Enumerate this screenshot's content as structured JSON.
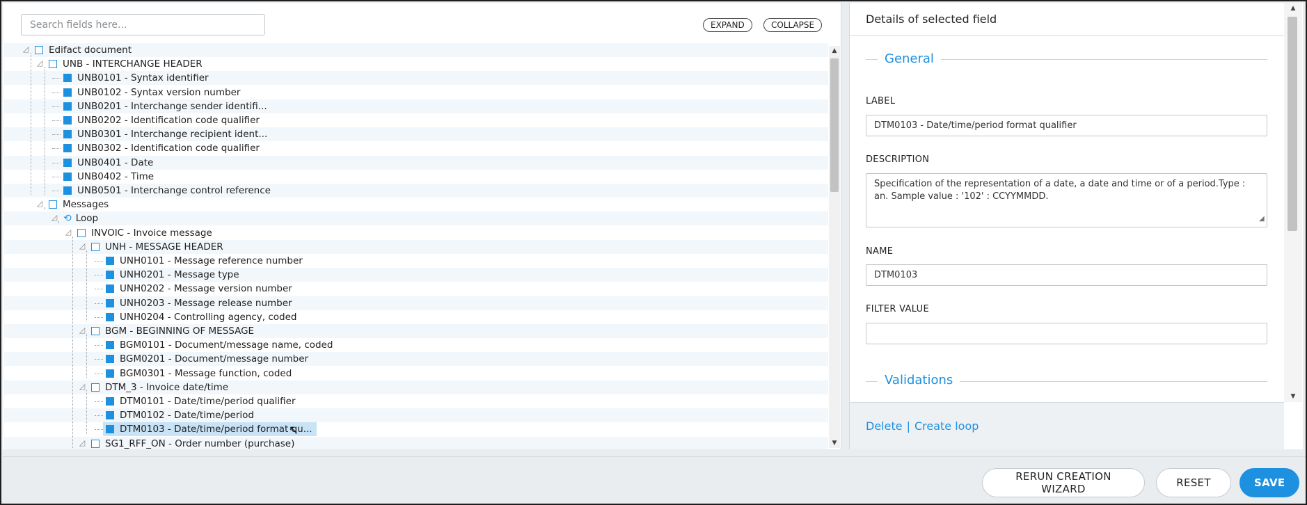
{
  "search": {
    "placeholder": "Search fields here..."
  },
  "toolbar": {
    "expand_label": "EXPAND",
    "collapse_label": "COLLAPSE"
  },
  "tree": {
    "rows": [
      {
        "label": "Edifact document",
        "depth": 0,
        "icon": "checkbox",
        "filled": false,
        "expander": true
      },
      {
        "label": "UNB - INTERCHANGE HEADER",
        "depth": 1,
        "icon": "checkbox",
        "filled": false,
        "expander": true
      },
      {
        "label": "UNB0101 - Syntax identifier",
        "depth": 2,
        "icon": "checkbox",
        "filled": true
      },
      {
        "label": "UNB0102 - Syntax version number",
        "depth": 2,
        "icon": "checkbox",
        "filled": true
      },
      {
        "label": "UNB0201 - Interchange sender identifi...",
        "depth": 2,
        "icon": "checkbox",
        "filled": true
      },
      {
        "label": "UNB0202 - Identification code qualifier",
        "depth": 2,
        "icon": "checkbox",
        "filled": true
      },
      {
        "label": "UNB0301 - Interchange recipient ident...",
        "depth": 2,
        "icon": "checkbox",
        "filled": true
      },
      {
        "label": "UNB0302 - Identification code qualifier",
        "depth": 2,
        "icon": "checkbox",
        "filled": true
      },
      {
        "label": "UNB0401 - Date",
        "depth": 2,
        "icon": "checkbox",
        "filled": true
      },
      {
        "label": "UNB0402 - Time",
        "depth": 2,
        "icon": "checkbox",
        "filled": true
      },
      {
        "label": "UNB0501 - Interchange control reference",
        "depth": 2,
        "icon": "checkbox",
        "filled": true
      },
      {
        "label": "Messages",
        "depth": 1,
        "icon": "checkbox",
        "filled": false,
        "expander": true
      },
      {
        "label": "Loop",
        "depth": 2,
        "icon": "loop-icon",
        "filled": false,
        "expander": true
      },
      {
        "label": "INVOIC - Invoice message",
        "depth": 3,
        "icon": "checkbox",
        "filled": false,
        "expander": true
      },
      {
        "label": "UNH - MESSAGE HEADER",
        "depth": 4,
        "icon": "checkbox",
        "filled": false,
        "expander": true
      },
      {
        "label": "UNH0101 - Message reference number",
        "depth": 5,
        "icon": "checkbox",
        "filled": true
      },
      {
        "label": "UNH0201 - Message type",
        "depth": 5,
        "icon": "checkbox",
        "filled": true
      },
      {
        "label": "UNH0202 - Message version number",
        "depth": 5,
        "icon": "checkbox",
        "filled": true
      },
      {
        "label": "UNH0203 - Message release number",
        "depth": 5,
        "icon": "checkbox",
        "filled": true
      },
      {
        "label": "UNH0204 - Controlling agency, coded",
        "depth": 5,
        "icon": "checkbox",
        "filled": true
      },
      {
        "label": "BGM - BEGINNING OF MESSAGE",
        "depth": 4,
        "icon": "checkbox",
        "filled": false,
        "expander": true
      },
      {
        "label": "BGM0101 - Document/message name, coded",
        "depth": 5,
        "icon": "checkbox",
        "filled": true
      },
      {
        "label": "BGM0201 - Document/message number",
        "depth": 5,
        "icon": "checkbox",
        "filled": true
      },
      {
        "label": "BGM0301 - Message function, coded",
        "depth": 5,
        "icon": "checkbox",
        "filled": true
      },
      {
        "label": "DTM_3 - Invoice date/time",
        "depth": 4,
        "icon": "checkbox",
        "filled": false,
        "expander": true
      },
      {
        "label": "DTM0101 - Date/time/period qualifier",
        "depth": 5,
        "icon": "checkbox",
        "filled": true
      },
      {
        "label": "DTM0102 - Date/time/period",
        "depth": 5,
        "icon": "checkbox",
        "filled": true
      },
      {
        "label": "DTM0103 - Date/time/period format qu...",
        "depth": 5,
        "icon": "checkbox",
        "filled": true,
        "selected": true
      },
      {
        "label": "SG1_RFF_ON - Order number (purchase)",
        "depth": 4,
        "icon": "checkbox",
        "filled": false,
        "expander": true
      }
    ]
  },
  "details": {
    "header": "Details of selected field",
    "general_title": "General",
    "label_caption": "LABEL",
    "label_value": "DTM0103 - Date/time/period format qualifier",
    "description_caption": "DESCRIPTION",
    "description_value": "Specification of the representation of a date, a date and time or of a period.Type : an. Sample value : '102' : CCYYMMDD.",
    "name_caption": "NAME",
    "name_value": "DTM0103",
    "filter_caption": "FILTER VALUE",
    "filter_value": "",
    "validations_title": "Validations",
    "delete_label": "Delete",
    "separator": "|",
    "create_loop_label": "Create loop"
  },
  "footer": {
    "rerun_label": "RERUN CREATION WIZARD",
    "reset_label": "RESET",
    "save_label": "SAVE"
  },
  "colors": {
    "accent": "#1e90e0",
    "selected_row": "#c9e3f6",
    "alt_row": "#f2f7fb"
  }
}
